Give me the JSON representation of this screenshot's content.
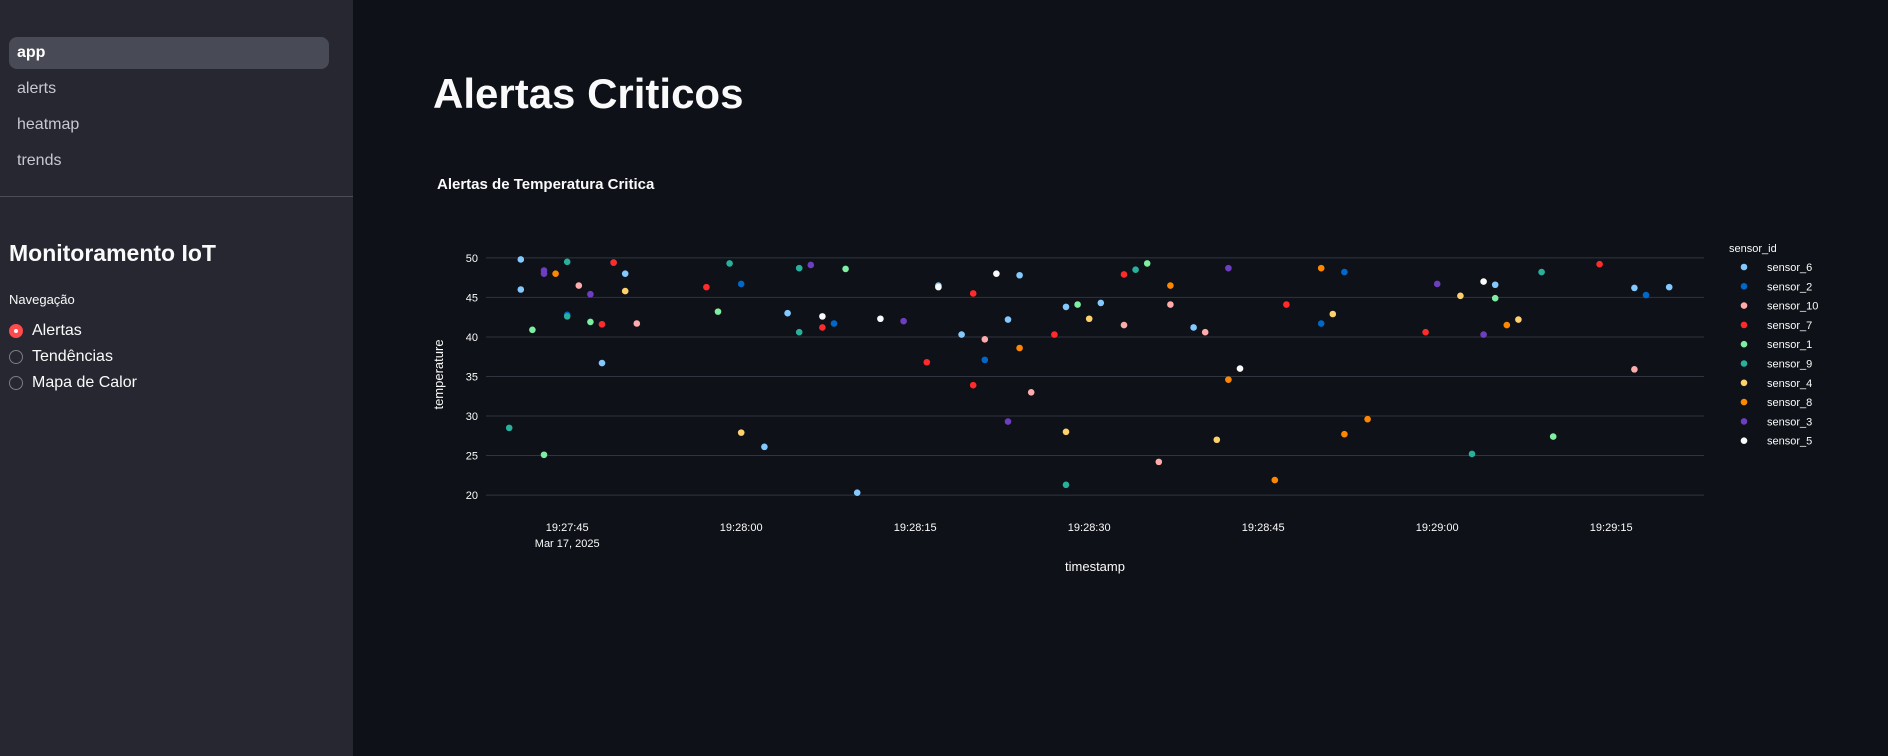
{
  "nav": {
    "pages": [
      {
        "label": "app",
        "active": true
      },
      {
        "label": "alerts",
        "active": false
      },
      {
        "label": "heatmap",
        "active": false
      },
      {
        "label": "trends",
        "active": false
      }
    ]
  },
  "sidebar": {
    "title": "Monitoramento IoT",
    "radio_label": "Navegação",
    "options": [
      {
        "label": "Alertas",
        "checked": true
      },
      {
        "label": "Tendências",
        "checked": false
      },
      {
        "label": "Mapa de Calor",
        "checked": false
      }
    ]
  },
  "main": {
    "title": "Alertas Criticos"
  },
  "chart_data": {
    "type": "scatter",
    "title": "Alertas de Temperatura Critica",
    "xlabel": "timestamp",
    "ylabel": "temperature",
    "x_date_label": "Mar 17, 2025",
    "x_ticks": [
      "19:27:45",
      "19:28:00",
      "19:28:15",
      "19:28:30",
      "19:28:45",
      "19:29:00",
      "19:29:15"
    ],
    "x_range": [
      "19:27:38",
      "19:29:23"
    ],
    "y_ticks": [
      20,
      25,
      30,
      35,
      40,
      45,
      50
    ],
    "ylim": [
      19,
      51.5
    ],
    "grid": true,
    "legend_title": "sensor_id",
    "legend_placement": "right",
    "series": [
      {
        "name": "sensor_6",
        "color": "#83c9ff",
        "points": [
          [
            "19:27:41",
            49.8
          ],
          [
            "19:27:41",
            46.0
          ],
          [
            "19:27:48",
            36.7
          ],
          [
            "19:27:50",
            48.0
          ],
          [
            "19:28:02",
            26.1
          ],
          [
            "19:28:04",
            43.0
          ],
          [
            "19:28:10",
            20.3
          ],
          [
            "19:28:17",
            46.5
          ],
          [
            "19:28:19",
            40.3
          ],
          [
            "19:28:23",
            42.2
          ],
          [
            "19:28:24",
            47.8
          ],
          [
            "19:28:28",
            43.8
          ],
          [
            "19:28:31",
            44.3
          ],
          [
            "19:28:39",
            41.2
          ],
          [
            "19:29:05",
            46.6
          ],
          [
            "19:29:17",
            46.2
          ],
          [
            "19:29:20",
            46.3
          ]
        ]
      },
      {
        "name": "sensor_2",
        "color": "#0068c9",
        "points": [
          [
            "19:27:45",
            42.8
          ],
          [
            "19:27:48",
            41.6
          ],
          [
            "19:27:49",
            49.4
          ],
          [
            "19:28:00",
            46.7
          ],
          [
            "19:28:08",
            41.7
          ],
          [
            "19:28:21",
            37.1
          ],
          [
            "19:28:50",
            41.7
          ],
          [
            "19:28:52",
            48.2
          ],
          [
            "19:29:18",
            45.3
          ]
        ]
      },
      {
        "name": "sensor_10",
        "color": "#ffabab",
        "points": [
          [
            "19:27:46",
            46.5
          ],
          [
            "19:27:51",
            41.7
          ],
          [
            "19:28:21",
            39.7
          ],
          [
            "19:28:25",
            33.0
          ],
          [
            "19:28:33",
            41.5
          ],
          [
            "19:28:36",
            24.2
          ],
          [
            "19:28:37",
            44.1
          ],
          [
            "19:28:40",
            40.6
          ],
          [
            "19:29:17",
            35.9
          ]
        ]
      },
      {
        "name": "sensor_7",
        "color": "#ff2b2b",
        "points": [
          [
            "19:27:48",
            41.6
          ],
          [
            "19:27:49",
            49.4
          ],
          [
            "19:27:57",
            46.3
          ],
          [
            "19:28:07",
            41.2
          ],
          [
            "19:28:16",
            36.8
          ],
          [
            "19:28:20",
            45.5
          ],
          [
            "19:28:20",
            33.9
          ],
          [
            "19:28:27",
            40.3
          ],
          [
            "19:28:33",
            47.9
          ],
          [
            "19:28:47",
            44.1
          ],
          [
            "19:28:59",
            40.6
          ],
          [
            "19:29:14",
            49.2
          ]
        ]
      },
      {
        "name": "sensor_1",
        "color": "#7defa1",
        "points": [
          [
            "19:27:42",
            40.9
          ],
          [
            "19:27:43",
            25.1
          ],
          [
            "19:27:47",
            41.9
          ],
          [
            "19:27:58",
            43.2
          ],
          [
            "19:28:09",
            48.6
          ],
          [
            "19:28:29",
            44.1
          ],
          [
            "19:28:35",
            49.3
          ],
          [
            "19:29:05",
            44.9
          ],
          [
            "19:29:10",
            27.4
          ]
        ]
      },
      {
        "name": "sensor_9",
        "color": "#29b09d",
        "points": [
          [
            "19:27:40",
            28.5
          ],
          [
            "19:27:45",
            49.5
          ],
          [
            "19:27:45",
            42.6
          ],
          [
            "19:27:59",
            49.3
          ],
          [
            "19:28:05",
            40.6
          ],
          [
            "19:28:05",
            48.7
          ],
          [
            "19:28:28",
            21.3
          ],
          [
            "19:28:34",
            48.5
          ],
          [
            "19:29:03",
            25.2
          ],
          [
            "19:29:09",
            48.2
          ]
        ]
      },
      {
        "name": "sensor_4",
        "color": "#ffd16a",
        "points": [
          [
            "19:27:50",
            45.8
          ],
          [
            "19:28:00",
            27.9
          ],
          [
            "19:28:28",
            28.0
          ],
          [
            "19:28:30",
            42.3
          ],
          [
            "19:28:41",
            27.0
          ],
          [
            "19:29:02",
            45.2
          ],
          [
            "19:29:07",
            42.2
          ],
          [
            "19:28:51",
            42.9
          ]
        ]
      },
      {
        "name": "sensor_8",
        "color": "#ff8700",
        "points": [
          [
            "19:27:44",
            48.0
          ],
          [
            "19:28:24",
            38.6
          ],
          [
            "19:28:37",
            46.5
          ],
          [
            "19:28:42",
            34.6
          ],
          [
            "19:28:46",
            21.9
          ],
          [
            "19:28:50",
            48.7
          ],
          [
            "19:28:52",
            27.7
          ],
          [
            "19:28:54",
            29.6
          ],
          [
            "19:29:06",
            41.5
          ]
        ]
      },
      {
        "name": "sensor_3",
        "color": "#6d3fc0",
        "points": [
          [
            "19:27:43",
            48.4
          ],
          [
            "19:27:43",
            48.0
          ],
          [
            "19:27:47",
            45.4
          ],
          [
            "19:28:06",
            49.1
          ],
          [
            "19:28:14",
            42.0
          ],
          [
            "19:28:23",
            29.3
          ],
          [
            "19:28:42",
            48.7
          ],
          [
            "19:29:00",
            46.7
          ],
          [
            "19:29:04",
            40.3
          ]
        ]
      },
      {
        "name": "sensor_5",
        "color": "#fafafa",
        "points": [
          [
            "19:28:07",
            42.6
          ],
          [
            "19:28:12",
            42.3
          ],
          [
            "19:28:17",
            46.3
          ],
          [
            "19:28:22",
            48.0
          ],
          [
            "19:28:43",
            36.0
          ],
          [
            "19:29:04",
            47.0
          ]
        ]
      }
    ]
  }
}
